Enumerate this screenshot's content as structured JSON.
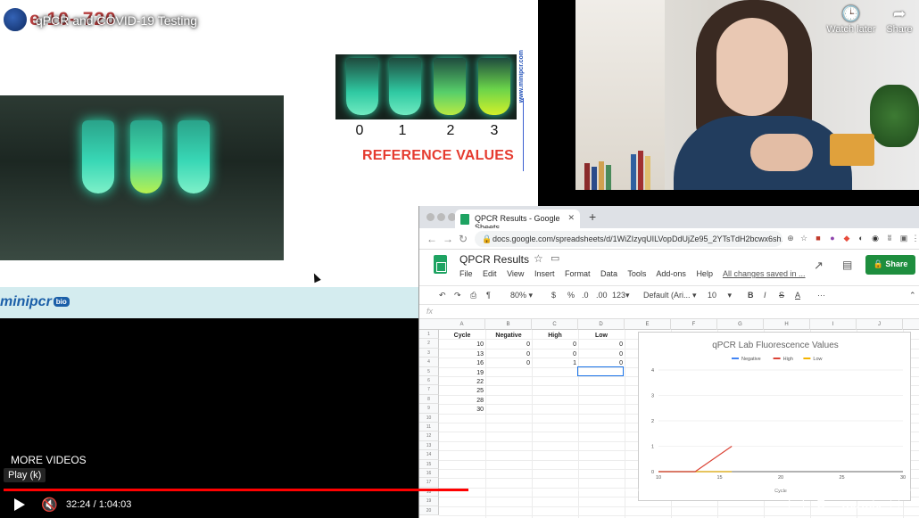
{
  "video": {
    "title": "qPCR and COVID-19 Testing",
    "watch_later": "Watch later",
    "share": "Share",
    "more_videos": "MORE VIDEOS",
    "play_tooltip": "Play (k)",
    "time": "32:24 / 1:04:03",
    "progress_fraction": 0.51,
    "youtube": "YouTube",
    "title_overlay": "e 10- 720"
  },
  "slide": {
    "reference_numbers": [
      "0",
      "1",
      "2",
      "3"
    ],
    "reference_title": "REFERENCE VALUES",
    "vertical_url": "www.minipcr.com",
    "brand": "minipcr",
    "brand_bio": "bio"
  },
  "browser": {
    "tab_title": "QPCR Results - Google Sheets",
    "url": "docs.google.com/spreadsheets/d/1WiZIzyqUILVopDdUjZe95_2YTsTdH2bcwx6sh..."
  },
  "sheet": {
    "doc_title": "QPCR Results",
    "menu": [
      "File",
      "Edit",
      "View",
      "Insert",
      "Format",
      "Data",
      "Tools",
      "Add-ons",
      "Help"
    ],
    "saved_status": "All changes saved in ...",
    "share_label": "Share",
    "toolbar": {
      "zoom": "80%",
      "currency": "$",
      "percent": "%",
      "dec_less": ".0",
      "dec_more": ".00",
      "number_format": "123",
      "font": "Default (Ari...",
      "font_size": "10",
      "bold": "B",
      "italic": "I",
      "strike": "S",
      "color": "A",
      "more": "···"
    },
    "fx": "fx",
    "columns": [
      "A",
      "B",
      "C",
      "D",
      "E",
      "F",
      "G",
      "H",
      "I",
      "J"
    ],
    "rows": [
      "1",
      "2",
      "3",
      "4",
      "5",
      "6",
      "7",
      "8",
      "9",
      "10",
      "11",
      "12",
      "13",
      "14",
      "15",
      "16",
      "17",
      "18",
      "19",
      "20"
    ],
    "headers": [
      "Cycle",
      "Negative",
      "High",
      "Low"
    ],
    "cycles": [
      "10",
      "13",
      "16",
      "19",
      "22",
      "25",
      "28",
      "30"
    ],
    "negative": [
      "0",
      "0",
      "0"
    ],
    "high": [
      "0",
      "0",
      "1"
    ],
    "low": [
      "0",
      "0",
      "0"
    ]
  },
  "chart_data": {
    "type": "line",
    "title": "qPCR Lab Fluorescence Values",
    "xlabel": "Cycle",
    "ylabel": "",
    "x": [
      10,
      13,
      16
    ],
    "xticks": [
      10,
      15,
      20,
      25,
      30
    ],
    "yticks": [
      0,
      1,
      2,
      3,
      4
    ],
    "xlim": [
      10,
      30
    ],
    "ylim": [
      0,
      4
    ],
    "legend_position": "top",
    "series": [
      {
        "name": "Negative",
        "values": [
          0,
          0,
          0
        ],
        "color": "#4285f4"
      },
      {
        "name": "High",
        "values": [
          0,
          0,
          1
        ],
        "color": "#db4437"
      },
      {
        "name": "Low",
        "values": [
          0,
          0,
          0
        ],
        "color": "#f4b400"
      }
    ]
  }
}
